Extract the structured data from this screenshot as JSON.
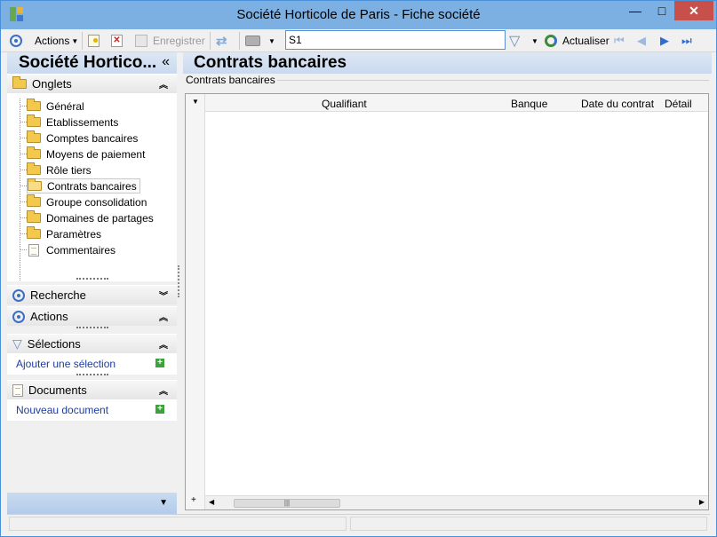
{
  "window": {
    "title": "Société Horticole de Paris  -  Fiche société",
    "minimize": "—",
    "maximize": "□",
    "close": "✕"
  },
  "toolbar": {
    "actions_label": "Actions",
    "save_label": "Enregistrer",
    "search_value": "S1",
    "refresh_label": "Actualiser"
  },
  "left_panel": {
    "title": "Société Hortico...",
    "collapse_glyph": "«",
    "onglets": {
      "label": "Onglets",
      "items": [
        {
          "label": "Général",
          "icon": "folder-icon"
        },
        {
          "label": "Etablissements",
          "icon": "folder-icon"
        },
        {
          "label": "Comptes bancaires",
          "icon": "folder-icon"
        },
        {
          "label": "Moyens de paiement",
          "icon": "folder-icon"
        },
        {
          "label": "Rôle tiers",
          "icon": "folder-icon"
        },
        {
          "label": "Contrats bancaires",
          "icon": "folder-open-icon",
          "selected": true
        },
        {
          "label": "Groupe consolidation",
          "icon": "folder-icon"
        },
        {
          "label": "Domaines de partages",
          "icon": "folder-icon"
        },
        {
          "label": "Paramètres",
          "icon": "folder-icon"
        },
        {
          "label": "Commentaires",
          "icon": "document-icon"
        }
      ]
    },
    "recherche": {
      "label": "Recherche"
    },
    "actions": {
      "label": "Actions"
    },
    "selections": {
      "label": "Sélections",
      "link": "Ajouter une sélection"
    },
    "documents": {
      "label": "Documents",
      "link": "Nouveau document"
    }
  },
  "main": {
    "title": "Contrats bancaires",
    "group_label": "Contrats bancaires",
    "columns": [
      "Qualifiant",
      "Banque",
      "Date du contrat",
      "Détail"
    ]
  },
  "colors": {
    "titlebar": "#7cb0e3",
    "close_button": "#c7504a",
    "accent": "#3a6fc4",
    "link": "#1f3d9c"
  }
}
